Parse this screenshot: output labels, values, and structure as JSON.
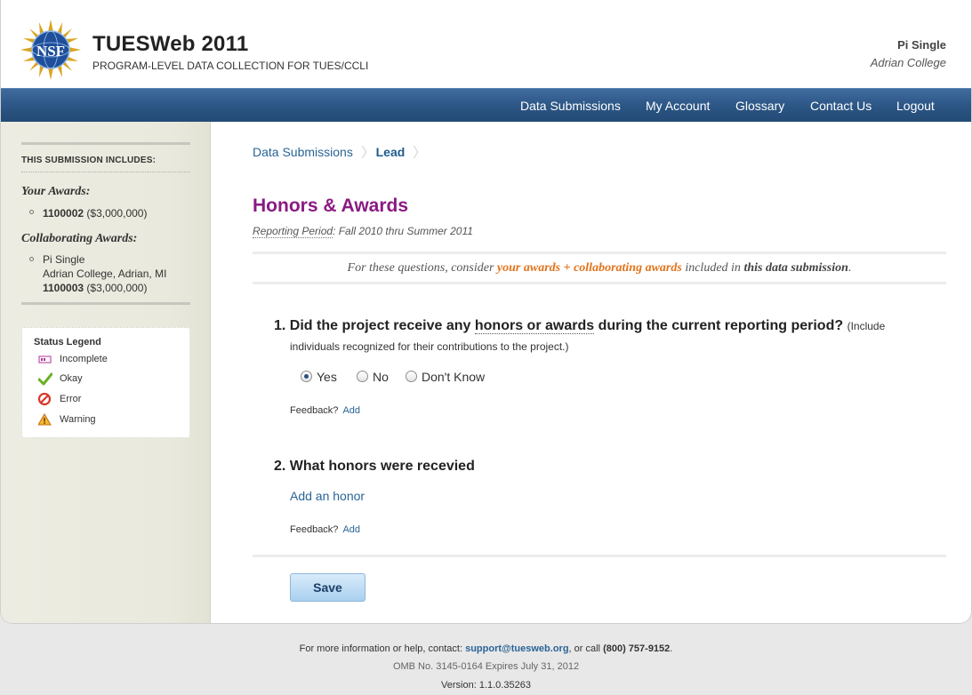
{
  "header": {
    "title": "TUESWeb 2011",
    "subtitle": "PROGRAM-LEVEL DATA COLLECTION FOR TUES/CCLI",
    "logo_text": "NSF",
    "user_name": "Pi Single",
    "user_org": "Adrian College"
  },
  "nav": {
    "items": [
      "Data Submissions",
      "My Account",
      "Glossary",
      "Contact Us",
      "Logout"
    ]
  },
  "sidebar": {
    "title": "THIS SUBMISSION INCLUDES:",
    "your_awards_heading": "Your Awards:",
    "your_awards": [
      {
        "id": "1100002",
        "amount": "($3,000,000)"
      }
    ],
    "collab_heading": "Collaborating Awards:",
    "collab_awards": [
      {
        "name": "Pi Single",
        "location": "Adrian College, Adrian, MI",
        "id": "1100003",
        "amount": "($3,000,000)"
      }
    ],
    "legend": {
      "title": "Status Legend",
      "items": [
        {
          "label": "Incomplete",
          "icon": "incomplete-icon",
          "color": "#b0329a"
        },
        {
          "label": "Okay",
          "icon": "check-icon",
          "color": "#6ab023"
        },
        {
          "label": "Error",
          "icon": "error-icon",
          "color": "#d9362a"
        },
        {
          "label": "Warning",
          "icon": "warning-icon",
          "color": "#e89a1a"
        }
      ]
    }
  },
  "breadcrumb": {
    "items": [
      "Data Submissions"
    ],
    "current": "Lead"
  },
  "main": {
    "title": "Honors & Awards",
    "period_label": "Reporting Period",
    "period_value": ": Fall 2010 thru Summer 2011",
    "note": {
      "pre": "For these questions, consider ",
      "accent": "your awards + collaborating awards",
      "mid": " included in ",
      "strong": "this data submission",
      "post": "."
    },
    "q1": {
      "pre": "1. Did the project receive any ",
      "term": "honors or awards",
      "post": " during the current reporting period? ",
      "small": "(Include",
      "continuation": "individuals recognized for their contributions to the project.)",
      "options": [
        "Yes",
        "No",
        "Don't Know"
      ],
      "selected": "Yes"
    },
    "q2": {
      "text": "2. What honors were recevied",
      "add_link": "Add an honor"
    },
    "feedback_label": "Feedback?",
    "feedback_link": "Add",
    "save_label": "Save"
  },
  "footer": {
    "line1_pre": "For more information or help, contact: ",
    "email": "support@tuesweb.org",
    "line1_mid": ", or call ",
    "phone": "(800) 757-9152",
    "line1_post": ".",
    "omb": "OMB No. 3145-0164 Expires July 31, 2012",
    "version": "Version: 1.1.0.35263"
  },
  "colors": {
    "nav_bg": "#2b5584",
    "title_purple": "#8a1a82",
    "accent_orange": "#e2731b",
    "link_blue": "#2a6496"
  }
}
